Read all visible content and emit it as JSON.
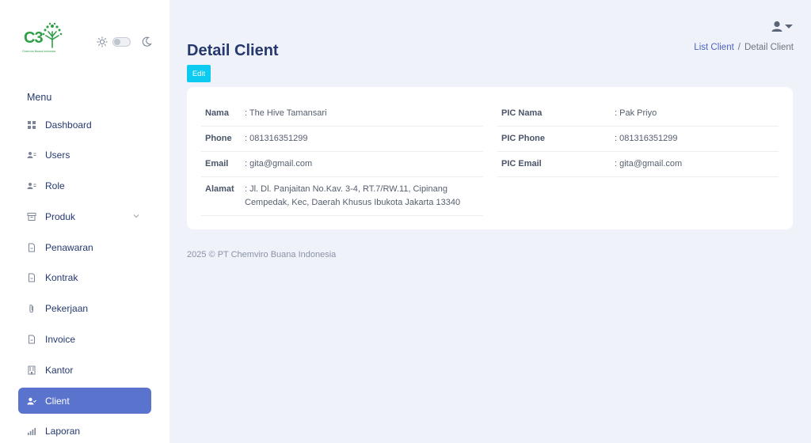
{
  "brand": {
    "logo_text": "C3",
    "tagline": "Chemviro Buana Indonesia",
    "accent": "#2f9f48"
  },
  "sidebar": {
    "menu_title": "Menu",
    "items": [
      {
        "label": "Dashboard",
        "icon": "grid-icon",
        "active": false
      },
      {
        "label": "Users",
        "icon": "user-list-icon",
        "active": false
      },
      {
        "label": "Role",
        "icon": "user-list-icon",
        "active": false
      },
      {
        "label": "Produk",
        "icon": "archive-icon",
        "active": false,
        "has_submenu": true
      },
      {
        "label": "Penawaran",
        "icon": "document-icon",
        "active": false
      },
      {
        "label": "Kontrak",
        "icon": "document-icon",
        "active": false
      },
      {
        "label": "Pekerjaan",
        "icon": "paperclip-icon",
        "active": false
      },
      {
        "label": "Invoice",
        "icon": "document-icon",
        "active": false
      },
      {
        "label": "Kantor",
        "icon": "building-icon",
        "active": false
      },
      {
        "label": "Client",
        "icon": "user-check-icon",
        "active": true
      },
      {
        "label": "Laporan",
        "icon": "bar-chart-icon",
        "active": false
      }
    ],
    "active_color": "#5a73cc"
  },
  "header": {
    "title": "Detail Client",
    "breadcrumb": {
      "link": "List Client",
      "separator": "/",
      "current": "Detail Client"
    },
    "edit_label": "Edit"
  },
  "client": {
    "left": [
      {
        "key": "Nama",
        "value": ": The Hive Tamansari"
      },
      {
        "key": "Phone",
        "value": ": 081316351299"
      },
      {
        "key": "Email",
        "value": ": gita@gmail.com"
      },
      {
        "key": "Alamat",
        "value": ": Jl. Dl. Panjaitan No.Kav. 3-4, RT.7/RW.11, Cipinang Cempedak, Kec, Daerah Khusus Ibukota Jakarta 13340"
      }
    ],
    "right": [
      {
        "key": "PIC Nama",
        "value": ": Pak Priyo"
      },
      {
        "key": "PIC Phone",
        "value": ": 081316351299"
      },
      {
        "key": "PIC Email",
        "value": ": gita@gmail.com"
      }
    ]
  },
  "footer": {
    "text": "2025 © PT Chemviro Buana Indonesia"
  }
}
